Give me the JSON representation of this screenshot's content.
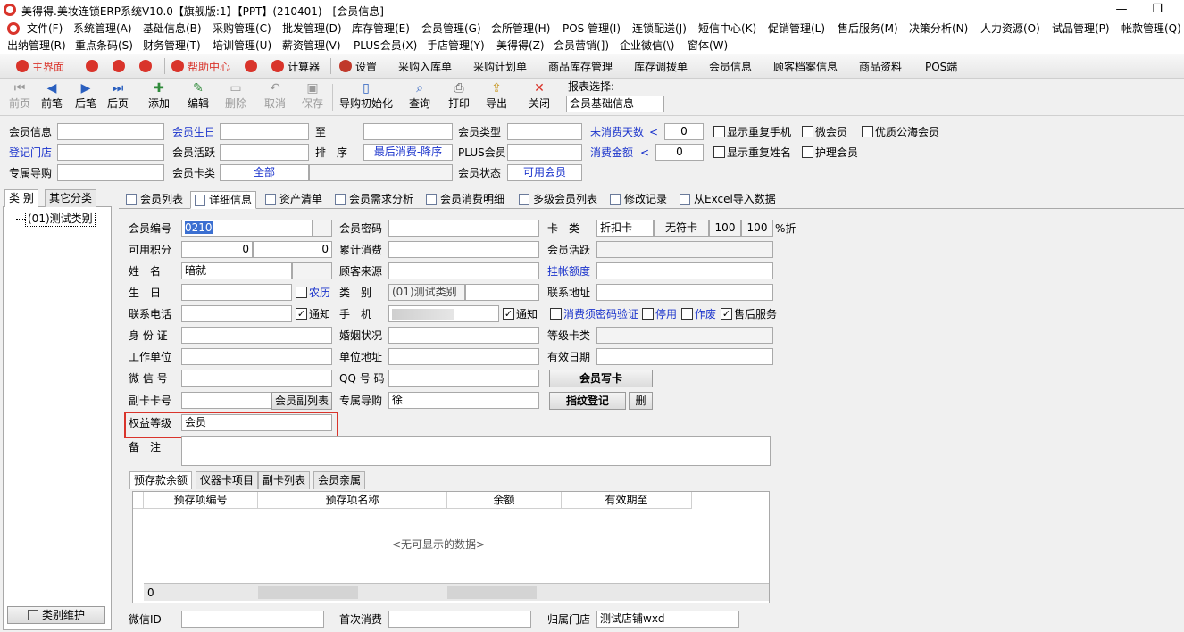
{
  "window": {
    "title": "美得得.美妆连锁ERP系统V10.0【旗舰版:1】【PPT】(210401) - [会员信息]",
    "minimize": "—",
    "restore": "❐"
  },
  "menu": {
    "row1": [
      "文件(F)",
      "系统管理(A)",
      "基础信息(B)",
      "采购管理(C)",
      "批发管理(D)",
      "库存管理(E)",
      "会员管理(G)",
      "会所管理(H)",
      "POS 管理(I)",
      "连锁配送(J)",
      "短信中心(K)",
      "促销管理(L)",
      "售后服务(M)",
      "决策分析(N)",
      "人力资源(O)",
      "试品管理(P)",
      "帐款管理(Q)"
    ],
    "row2": [
      "出纳管理(R)",
      "重点条码(S)",
      "财务管理(T)",
      "培训管理(U)",
      "薪资管理(V)",
      "PLUS会员(X)",
      "手店管理(Y)",
      "美得得(Z)",
      "会员营销(])",
      "企业微信(\\)",
      "窗体(W)"
    ]
  },
  "quickbar": {
    "home": "主界面",
    "help": "帮助中心",
    "calculator": "计算器",
    "settings": "设置",
    "links": [
      "采购入库单",
      "采购计划单",
      "商品库存管理",
      "库存调拨单",
      "会员信息",
      "顾客档案信息",
      "商品资料",
      "POS端"
    ]
  },
  "toolbar": {
    "buttons": [
      "前页",
      "前笔",
      "后笔",
      "后页",
      "添加",
      "编辑",
      "删除",
      "取消",
      "保存",
      "导购初始化",
      "查询",
      "打印",
      "导出",
      "关闭"
    ],
    "report_label": "报表选择:",
    "report_value": "会员基础信息"
  },
  "filter": {
    "member_info": "会员信息",
    "member_birthday": "会员生日",
    "to": "至",
    "member_type": "会员类型",
    "no_consume_days": "未消费天数",
    "lt": "<",
    "no_consume_days_value": "0",
    "show_dup_phone": "显示重复手机",
    "wechat_member": "微会员",
    "quality_member": "优质公海会员",
    "register_store": "登记门店",
    "member_active": "会员活跃",
    "sort_label": "排　序",
    "sort_value": "最后消费-降序",
    "plus_member": "PLUS会员",
    "consume_amount": "消费金额",
    "consume_amount_value": "0",
    "show_dup_name": "显示重复姓名",
    "care_member": "护理会员",
    "exclusive_guide": "专属导购",
    "card_type": "会员卡类",
    "card_type_value": "全部",
    "member_status": "会员状态",
    "member_status_value": "可用会员"
  },
  "left": {
    "tab_category": "类 别",
    "tab_other": "其它分类",
    "tree_node": "(01)测试类别",
    "maintain_button": "类别维护"
  },
  "tabs": [
    "会员列表",
    "详细信息",
    "资产清单",
    "会员需求分析",
    "会员消费明细",
    "多级会员列表",
    "修改记录",
    "从Excel导入数据"
  ],
  "detail": {
    "member_no_label": "会员编号",
    "member_no_value": "0210",
    "member_pwd_label": "会员密码",
    "card_type_label": "卡　类",
    "card_type_value": "折扣卡",
    "card_sub": "无符卡",
    "discount1": "100",
    "discount2": "100",
    "discount_unit": "%折",
    "points_label": "可用积分",
    "points1": "0",
    "points2": "0",
    "total_consume_label": "累计消费",
    "member_active_label": "会员活跃",
    "name_label": "姓　名",
    "name_value": "暗就",
    "customer_source_label": "顾客来源",
    "credit_label": "挂帐额度",
    "birthday_label": "生　日",
    "lunar_label": "农历",
    "category_label": "类　别",
    "category_value": "(01)测试类别",
    "address_label": "联系地址",
    "phone_label": "联系电话",
    "notify_label": "通知",
    "mobile_label": "手　机",
    "notify2_label": "通知",
    "pwd_verify_label": "消费须密码验证",
    "disabled_label": "停用",
    "void_label": "作废",
    "after_sale_label": "售后服务",
    "id_label": "身 份 证",
    "marriage_label": "婚姻状况",
    "level_card_label": "等级卡类",
    "work_label": "工作单位",
    "work_addr_label": "单位地址",
    "valid_label": "有效日期",
    "wechat_label": "微 信 号",
    "qq_label": "QQ 号 码",
    "write_card_button": "会员写卡",
    "sub_card_label": "副卡卡号",
    "sub_card_button": "会员副列表",
    "guide_label": "专属导购",
    "guide_value": "徐",
    "fingerprint_button": "指纹登记",
    "delete_small": "删",
    "rights_label": "权益等级",
    "rights_value": "会员",
    "remark_label": "备　注",
    "wechat_id_label": "微信ID",
    "first_consume_label": "首次消费",
    "home_store_label": "归属门店",
    "home_store_value": "测试店铺wxd"
  },
  "subtabs": [
    "预存款余额",
    "仪器卡项目",
    "副卡列表",
    "会员亲属"
  ],
  "grid": {
    "headers": [
      "预存项编号",
      "预存项名称",
      "余额",
      "有效期至"
    ],
    "empty": "<无可显示的数据>",
    "footer_count": "0"
  },
  "colors": {
    "accent_red": "#d9342b",
    "link_blue": "#1a33cc"
  }
}
